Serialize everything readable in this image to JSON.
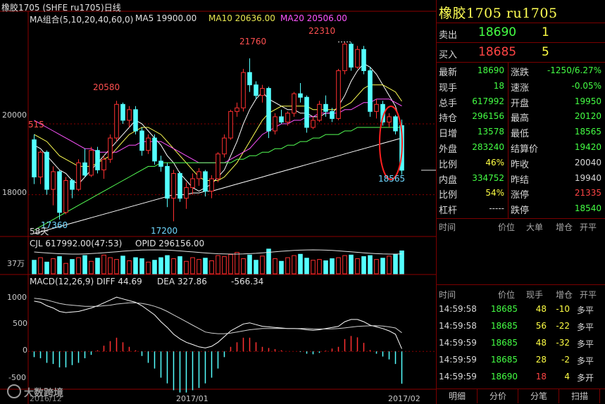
{
  "title_bar": {
    "text": "橡胶1705 (SHFE ru1705)日线"
  },
  "ma_legend": {
    "label": "MA组合(5,10,20,40,60,0)",
    "ma5": "MA5 19900.00",
    "ma10": "MA10 20636.00",
    "ma20": "MA20 20506.00"
  },
  "price_labels": {
    "high": "22310",
    "low_marker": "18565",
    "peak1": "21760",
    "peak2": "20580",
    "trough1": "17360",
    "trough2": "17200",
    "left_cut": "515",
    "days": "58天"
  },
  "y_ticks": {
    "p20000": "20000",
    "p18000": "18000",
    "v37": "37万",
    "m1000": "1000",
    "m500": "500",
    "m0": "0",
    "mneg500": "-500"
  },
  "volume_header": {
    "cjl": "CJL  617992.00(47:53)",
    "opid": "OPID  296156.00"
  },
  "macd_header": {
    "label": "MACD(12,26,9)",
    "diff": "DIFF  44.69",
    "dea": "DEA  327.86",
    "macd": "-566.34"
  },
  "x_ticks": {
    "jan": "2017/01",
    "feb": "2017/02",
    "dec": "2016/12"
  },
  "watermark": "大数跨境",
  "colors": {
    "up": "#ff3030",
    "down": "#54ffff",
    "ma5": "#ffffff",
    "ma10": "#ffff54",
    "ma20": "#ff54ff",
    "ma40": "#54ff54",
    "ma60": "#ffffff",
    "grid": "#8b0000"
  },
  "panel": {
    "symbol_title": "橡胶1705  ru1705",
    "sell": {
      "label": "卖出",
      "price": "18690",
      "qty": "1"
    },
    "buy": {
      "label": "买入",
      "price": "18685",
      "qty": "5"
    },
    "quote": [
      {
        "l1": "最新",
        "v1": "18690",
        "c1": "green",
        "l2": "涨跌",
        "v2": "-1250/6.27%",
        "c2": "green"
      },
      {
        "l1": "现手",
        "v1": "18",
        "c1": "green",
        "l2": "速涨",
        "v2": "-0.05%",
        "c2": "green"
      },
      {
        "l1": "总手",
        "v1": "617992",
        "c1": "green",
        "l2": "开盘",
        "v2": "19950",
        "c2": "green"
      },
      {
        "l1": "持仓",
        "v1": "296156",
        "c1": "green",
        "l2": "最高",
        "v2": "20120",
        "c2": "green"
      },
      {
        "l1": "日增",
        "v1": "13578",
        "c1": "green",
        "l2": "最低",
        "v2": "18565",
        "c2": "green"
      },
      {
        "l1": "外盘",
        "v1": "283240",
        "c1": "green",
        "l2": "结算价",
        "v2": "19420",
        "c2": "green"
      },
      {
        "l1": "比例",
        "v1": "46%",
        "c1": "yellow",
        "l2": "昨收",
        "v2": "20040",
        "c2": "white"
      },
      {
        "l1": "内盘",
        "v1": "334752",
        "c1": "green",
        "l2": "昨结",
        "v2": "19940",
        "c2": "white"
      },
      {
        "l1": "比例",
        "v1": "54%",
        "c1": "yellow",
        "l2": "涨停",
        "v2": "21335",
        "c2": "red"
      },
      {
        "l1": "杠杆",
        "v1": "-----",
        "c1": "white",
        "l2": "跌停",
        "v2": "18540",
        "c2": "green"
      }
    ],
    "mid_header": [
      "时间",
      "价位",
      "大单",
      "增仓",
      "开平"
    ],
    "ticks_header": [
      "时间",
      "价位",
      "现手",
      "增仓",
      "开平"
    ],
    "ticks": [
      {
        "time": "14:59:58",
        "price": "18685",
        "qty": "48",
        "oi": "-10",
        "type": "多平"
      },
      {
        "time": "14:59:58",
        "price": "18685",
        "qty": "56",
        "oi": "-22",
        "type": "多平"
      },
      {
        "time": "14:59:59",
        "price": "18685",
        "qty": "48",
        "oi": "-32",
        "type": "多平"
      },
      {
        "time": "14:59:59",
        "price": "18685",
        "qty": "28",
        "oi": "-2",
        "type": "多平"
      },
      {
        "time": "14:59:59",
        "price": "18690",
        "qty": "18",
        "oi": "4",
        "type": "多开"
      }
    ],
    "tabs": [
      "明细",
      "分价",
      "分笔",
      "扫描"
    ]
  },
  "chart_data": {
    "type": "candlestick",
    "title": "橡胶1705 (SHFE ru1705)日线",
    "y_range": [
      16900,
      22800
    ],
    "ohlc": [
      [
        19550,
        19700,
        18300,
        18500
      ],
      [
        18500,
        19250,
        18300,
        19200
      ],
      [
        19200,
        19250,
        18000,
        18150
      ],
      [
        18150,
        18800,
        17700,
        18650
      ],
      [
        18650,
        18700,
        17300,
        17500
      ],
      [
        17500,
        18500,
        17450,
        18400
      ],
      [
        18400,
        18450,
        17900,
        18150
      ],
      [
        18150,
        19000,
        18100,
        18900
      ],
      [
        18900,
        19300,
        18500,
        18550
      ],
      [
        18550,
        19350,
        18500,
        19250
      ],
      [
        19250,
        19350,
        18600,
        18700
      ],
      [
        18700,
        19100,
        18450,
        19000
      ],
      [
        19000,
        19700,
        18900,
        19600
      ],
      [
        19600,
        20650,
        19500,
        20550
      ],
      [
        20550,
        20600,
        20000,
        20100
      ],
      [
        20100,
        20500,
        19900,
        20400
      ],
      [
        20400,
        20500,
        19700,
        19800
      ],
      [
        19800,
        19900,
        19100,
        19250
      ],
      [
        19250,
        19700,
        19150,
        19600
      ],
      [
        19600,
        19700,
        18850,
        18950
      ],
      [
        18950,
        19100,
        18650,
        18800
      ],
      [
        18800,
        18900,
        17650,
        17900
      ],
      [
        17900,
        18700,
        17250,
        18600
      ],
      [
        18600,
        18650,
        17800,
        17900
      ],
      [
        17900,
        18350,
        17600,
        18200
      ],
      [
        18200,
        18600,
        18000,
        18450
      ],
      [
        18450,
        18750,
        18250,
        18650
      ],
      [
        18650,
        18700,
        17950,
        18100
      ],
      [
        18100,
        18550,
        17900,
        18450
      ],
      [
        18450,
        19200,
        18350,
        19150
      ],
      [
        19150,
        19700,
        19050,
        19600
      ],
      [
        19600,
        20400,
        19550,
        20350
      ],
      [
        20350,
        20600,
        20200,
        20450
      ],
      [
        20450,
        21550,
        20350,
        21450
      ],
      [
        21450,
        21850,
        20900,
        21100
      ],
      [
        21100,
        21200,
        20700,
        20800
      ],
      [
        20800,
        21100,
        20600,
        21000
      ],
      [
        21000,
        21050,
        19600,
        19800
      ],
      [
        19800,
        20300,
        19700,
        20200
      ],
      [
        20200,
        20400,
        20000,
        20050
      ],
      [
        20050,
        20350,
        19950,
        20300
      ],
      [
        20300,
        20900,
        20200,
        20850
      ],
      [
        20850,
        21150,
        20600,
        20750
      ],
      [
        20750,
        20800,
        19750,
        19900
      ],
      [
        19900,
        20200,
        19850,
        20100
      ],
      [
        20100,
        20650,
        20050,
        20550
      ],
      [
        20550,
        20800,
        20200,
        20350
      ],
      [
        20350,
        20450,
        20050,
        20150
      ],
      [
        20150,
        21550,
        20100,
        21500
      ],
      [
        21500,
        22310,
        21400,
        22250
      ],
      [
        22250,
        22300,
        21500,
        21600
      ],
      [
        21600,
        22200,
        21550,
        22100
      ],
      [
        22100,
        22200,
        21400,
        21500
      ],
      [
        21500,
        21600,
        20200,
        20350
      ],
      [
        20350,
        20700,
        20150,
        20550
      ],
      [
        20550,
        20650,
        19950,
        20050
      ],
      [
        20050,
        20300,
        19900,
        20200
      ],
      [
        20200,
        20250,
        19700,
        19800
      ],
      [
        19950,
        20120,
        18565,
        18690
      ]
    ],
    "volume_shape": [
      0.52,
      0.62,
      0.45,
      0.58,
      0.66,
      0.4,
      0.55,
      0.62,
      0.7,
      0.48,
      0.6,
      0.72,
      0.62,
      0.55,
      0.68,
      0.5,
      0.62,
      0.58,
      0.45,
      0.52,
      0.62,
      0.7,
      0.58,
      0.66,
      0.48,
      0.62,
      0.55,
      0.6,
      0.5,
      0.7,
      0.66,
      0.74,
      0.82,
      0.58,
      0.72,
      0.52,
      0.68,
      0.95,
      0.58,
      0.48,
      0.62,
      0.7,
      0.75,
      0.6,
      0.52,
      0.55,
      0.5,
      0.58,
      0.62,
      0.7,
      0.72,
      0.58,
      0.66,
      0.7,
      0.55,
      0.6,
      0.68,
      0.74,
      0.88
    ],
    "macd_range": [
      -650,
      1150
    ],
    "diff": [
      880,
      860,
      800,
      760,
      700,
      680,
      690,
      700,
      730,
      760,
      800,
      850,
      900,
      950,
      920,
      890,
      860,
      800,
      720,
      640,
      520,
      420,
      300,
      220,
      160,
      120,
      80,
      60,
      90,
      160,
      260,
      360,
      420,
      480,
      500,
      470,
      440,
      430,
      420,
      410,
      400,
      400,
      395,
      380,
      370,
      380,
      400,
      420,
      440,
      520,
      560,
      560,
      520,
      460,
      430,
      400,
      360,
      300,
      45
    ],
    "dea": [
      930,
      920,
      900,
      870,
      840,
      820,
      810,
      800,
      790,
      790,
      790,
      800,
      810,
      830,
      840,
      850,
      850,
      840,
      820,
      790,
      750,
      700,
      640,
      580,
      520,
      460,
      400,
      340,
      320,
      310,
      310,
      320,
      340,
      360,
      380,
      390,
      400,
      400,
      400,
      400,
      400,
      400,
      400,
      400,
      395,
      393,
      393,
      395,
      400,
      412,
      425,
      437,
      445,
      448,
      450,
      445,
      430,
      410,
      328
    ],
    "macd": [
      -100,
      -120,
      -200,
      -220,
      -280,
      -280,
      -240,
      -200,
      -120,
      -60,
      20,
      100,
      180,
      240,
      160,
      80,
      20,
      -80,
      -200,
      -300,
      -460,
      -560,
      -680,
      -720,
      -720,
      -680,
      -640,
      -560,
      -460,
      -300,
      -100,
      80,
      160,
      240,
      240,
      160,
      80,
      60,
      40,
      20,
      0,
      0,
      -10,
      -40,
      -50,
      -26,
      14,
      50,
      80,
      216,
      270,
      246,
      150,
      24,
      -40,
      -90,
      -140,
      -220,
      -566
    ],
    "ma_lines": {
      "ma5": [
        19400,
        19300,
        19100,
        18900,
        18700,
        18600,
        18400,
        18300,
        18500,
        18700,
        18900,
        19100,
        19300,
        19500,
        19700,
        19900,
        20100,
        20000,
        19800,
        19600,
        19400,
        19100,
        18900,
        18600,
        18400,
        18200,
        18100,
        18200,
        18300,
        18500,
        18700,
        19100,
        19500,
        20000,
        20400,
        20700,
        20900,
        20700,
        20600,
        20500,
        20400,
        20400,
        20300,
        20300,
        20200,
        20200,
        20300,
        20300,
        20500,
        20800,
        21200,
        21500,
        21700,
        21600,
        21400,
        21100,
        20800,
        20500,
        19900
      ],
      "ma10": [
        19700,
        19600,
        19500,
        19300,
        19100,
        19000,
        18900,
        18800,
        18800,
        18800,
        18900,
        19000,
        19100,
        19300,
        19500,
        19700,
        19800,
        19900,
        19900,
        19800,
        19700,
        19500,
        19300,
        19100,
        18900,
        18700,
        18500,
        18400,
        18400,
        18400,
        18500,
        18700,
        18900,
        19200,
        19500,
        19800,
        20100,
        20300,
        20400,
        20500,
        20500,
        20500,
        20500,
        20500,
        20400,
        20400,
        20400,
        20400,
        20400,
        20500,
        20600,
        20800,
        21000,
        21100,
        21100,
        21100,
        21000,
        20900,
        20636
      ],
      "ma20": [
        20100,
        20000,
        19900,
        19800,
        19700,
        19600,
        19500,
        19400,
        19300,
        19300,
        19200,
        19200,
        19200,
        19200,
        19300,
        19400,
        19400,
        19500,
        19500,
        19500,
        19500,
        19400,
        19300,
        19200,
        19100,
        19000,
        18900,
        18900,
        18900,
        18900,
        18900,
        19000,
        19100,
        19200,
        19300,
        19500,
        19700,
        19800,
        19900,
        20000,
        20000,
        20100,
        20100,
        20200,
        20200,
        20300,
        20300,
        20300,
        20300,
        20400,
        20400,
        20500,
        20600,
        20600,
        20700,
        20700,
        20700,
        20600,
        20506
      ],
      "ma40": [
        17000,
        17100,
        17200,
        17300,
        17400,
        17500,
        17600,
        17700,
        17800,
        17900,
        18000,
        18100,
        18200,
        18300,
        18400,
        18500,
        18600,
        18700,
        18800,
        18800,
        18900,
        18900,
        18900,
        18900,
        18900,
        18900,
        18900,
        18900,
        18900,
        18900,
        18900,
        18900,
        19000,
        19000,
        19100,
        19100,
        19200,
        19200,
        19300,
        19300,
        19400,
        19400,
        19500,
        19500,
        19600,
        19600,
        19700,
        19700,
        19700,
        19800,
        19800,
        19900,
        19900,
        19900,
        19900,
        19900,
        19900,
        19900,
        19900
      ],
      "ma60": [
        16900,
        16950,
        17000,
        17050,
        17100,
        17150,
        17200,
        17250,
        17300,
        17350,
        17400,
        17450,
        17500,
        17550,
        17600,
        17650,
        17700,
        17750,
        17800,
        17850,
        17900,
        17950,
        18000,
        18000,
        18000,
        18050,
        18050,
        18100,
        18100,
        18150,
        18200,
        18250,
        18300,
        18350,
        18400,
        18450,
        18500,
        18550,
        18600,
        18650,
        18700,
        18750,
        18800,
        18850,
        18900,
        18950,
        19000,
        19050,
        19100,
        19150,
        19200,
        19250,
        19300,
        19350,
        19400,
        19450,
        19500,
        19550,
        19600
      ]
    }
  }
}
